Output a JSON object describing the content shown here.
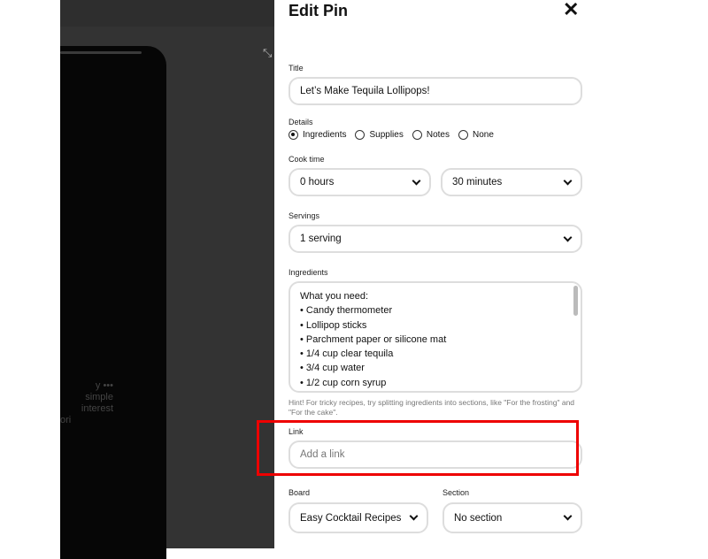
{
  "background_pin": {
    "text_lines": [
      "y •••",
      "simple",
      "interest",
      "ori"
    ]
  },
  "panel": {
    "title": "Edit Pin",
    "close_icon": "close-icon"
  },
  "title_field": {
    "label": "Title",
    "value": "Let’s Make Tequila  Lollipops!"
  },
  "details": {
    "label": "Details",
    "options": [
      {
        "label": "Ingredients",
        "selected": true
      },
      {
        "label": "Supplies",
        "selected": false
      },
      {
        "label": "Notes",
        "selected": false
      },
      {
        "label": "None",
        "selected": false
      }
    ]
  },
  "cook_time": {
    "label": "Cook time",
    "hours": "0 hours",
    "minutes": "30 minutes"
  },
  "servings": {
    "label": "Servings",
    "value": "1 serving"
  },
  "ingredients": {
    "label": "Ingredients",
    "lines": [
      "What you need:",
      "• Candy thermometer",
      "• Lollipop sticks",
      "• Parchment paper or silicone mat",
      "• 1/4 cup clear tequila",
      "• 3/4 cup water",
      "• 1/2 cup corn syrup"
    ],
    "hint": "Hint! For tricky recipes, try splitting ingredients into sections, like \"For the frosting\" and \"For the cake\"."
  },
  "link": {
    "label": "Link",
    "placeholder": "Add a link",
    "highlight_color": "#e00000"
  },
  "board": {
    "label": "Board",
    "value": "Easy Cocktail Recipes"
  },
  "section": {
    "label": "Section",
    "value": "No section"
  }
}
